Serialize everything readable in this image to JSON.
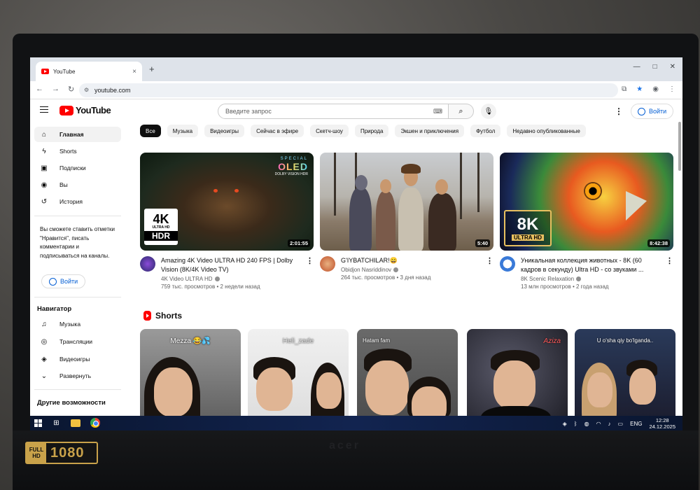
{
  "device": {
    "badge_full": "FULL",
    "badge_hd": "HD",
    "badge_res": "1080",
    "brand": "acer"
  },
  "browser": {
    "tab_title": "YouTube",
    "tab_close": "×",
    "new_tab": "+",
    "url": "youtube.com",
    "window_controls": [
      "—",
      "□",
      "✕"
    ]
  },
  "header": {
    "logo_text": "YouTube",
    "search_placeholder": "Введите запрос",
    "signin_label": "Войти"
  },
  "sidebar": {
    "items": [
      {
        "label": "Главная",
        "icon": "home-icon",
        "glyph": "⌂"
      },
      {
        "label": "Shorts",
        "icon": "shorts-icon",
        "glyph": "ϟ"
      },
      {
        "label": "Подписки",
        "icon": "subscriptions-icon",
        "glyph": "▣"
      },
      {
        "label": "Вы",
        "icon": "user-icon",
        "glyph": "◉"
      },
      {
        "label": "История",
        "icon": "history-icon",
        "glyph": "↺"
      }
    ],
    "note": "Вы сможете ставить отметки \"Нравится\", писать комментарии и подписываться на каналы.",
    "signin_label": "Войти",
    "navigator_heading": "Навигатор",
    "navigator_items": [
      {
        "label": "Музыка",
        "icon": "music-icon",
        "glyph": "♫"
      },
      {
        "label": "Трансляции",
        "icon": "live-icon",
        "glyph": "◎"
      },
      {
        "label": "Видеоигры",
        "icon": "gamepad-icon",
        "glyph": "◈"
      },
      {
        "label": "Развернуть",
        "icon": "chevron-down-icon",
        "glyph": "⌄"
      }
    ],
    "more_heading": "Другие возможности"
  },
  "chips": [
    "Все",
    "Музыка",
    "Видеоигры",
    "Сейчас в эфире",
    "Скетч-шоу",
    "Природа",
    "Экшен и приключения",
    "Футбол",
    "Недавно опубликованные"
  ],
  "videos": [
    {
      "title": "Amazing 4K Video ULTRA HD 240 FPS | Dolby Vision (8K/4K Video TV)",
      "channel": "4K Video ULTRA HD",
      "stats": "759 тыс. просмотров • 2 недели назад",
      "duration": "2:01:55",
      "badge_big": "4K",
      "badge_small": "ULTRA HD",
      "badge_hdr": "HDR",
      "oled_special": "SPECIAL",
      "oled_text": "OLED",
      "oled_dolby": "DOLBY VISION HDR"
    },
    {
      "title": "G'IYBATCHILAR!😄",
      "channel": "Obidjon Nasriddinov",
      "stats": "264 тыс. просмотров • 3 дня назад",
      "duration": "5:40"
    },
    {
      "title": "Уникальная коллекция животных - 8K (60 кадров в секунду) Ultra HD - со звуками ...",
      "channel": "8K Scenic Relaxation",
      "stats": "13 млн просмотров • 2 года назад",
      "duration": "8:42:38",
      "badge_big": "8K",
      "badge_small": "ULTRA HD"
    }
  ],
  "shorts": {
    "heading": "Shorts",
    "items": [
      {
        "caption": "Mezza 😂💦"
      },
      {
        "caption": "Heli_zade"
      },
      {
        "caption": "Hatam fam"
      },
      {
        "caption": "Aziza"
      },
      {
        "caption": "U o'sha qiy bo'lganda.."
      }
    ]
  },
  "taskbar": {
    "lang": "ENG",
    "time": "12:28",
    "date": "24.12.2025"
  }
}
